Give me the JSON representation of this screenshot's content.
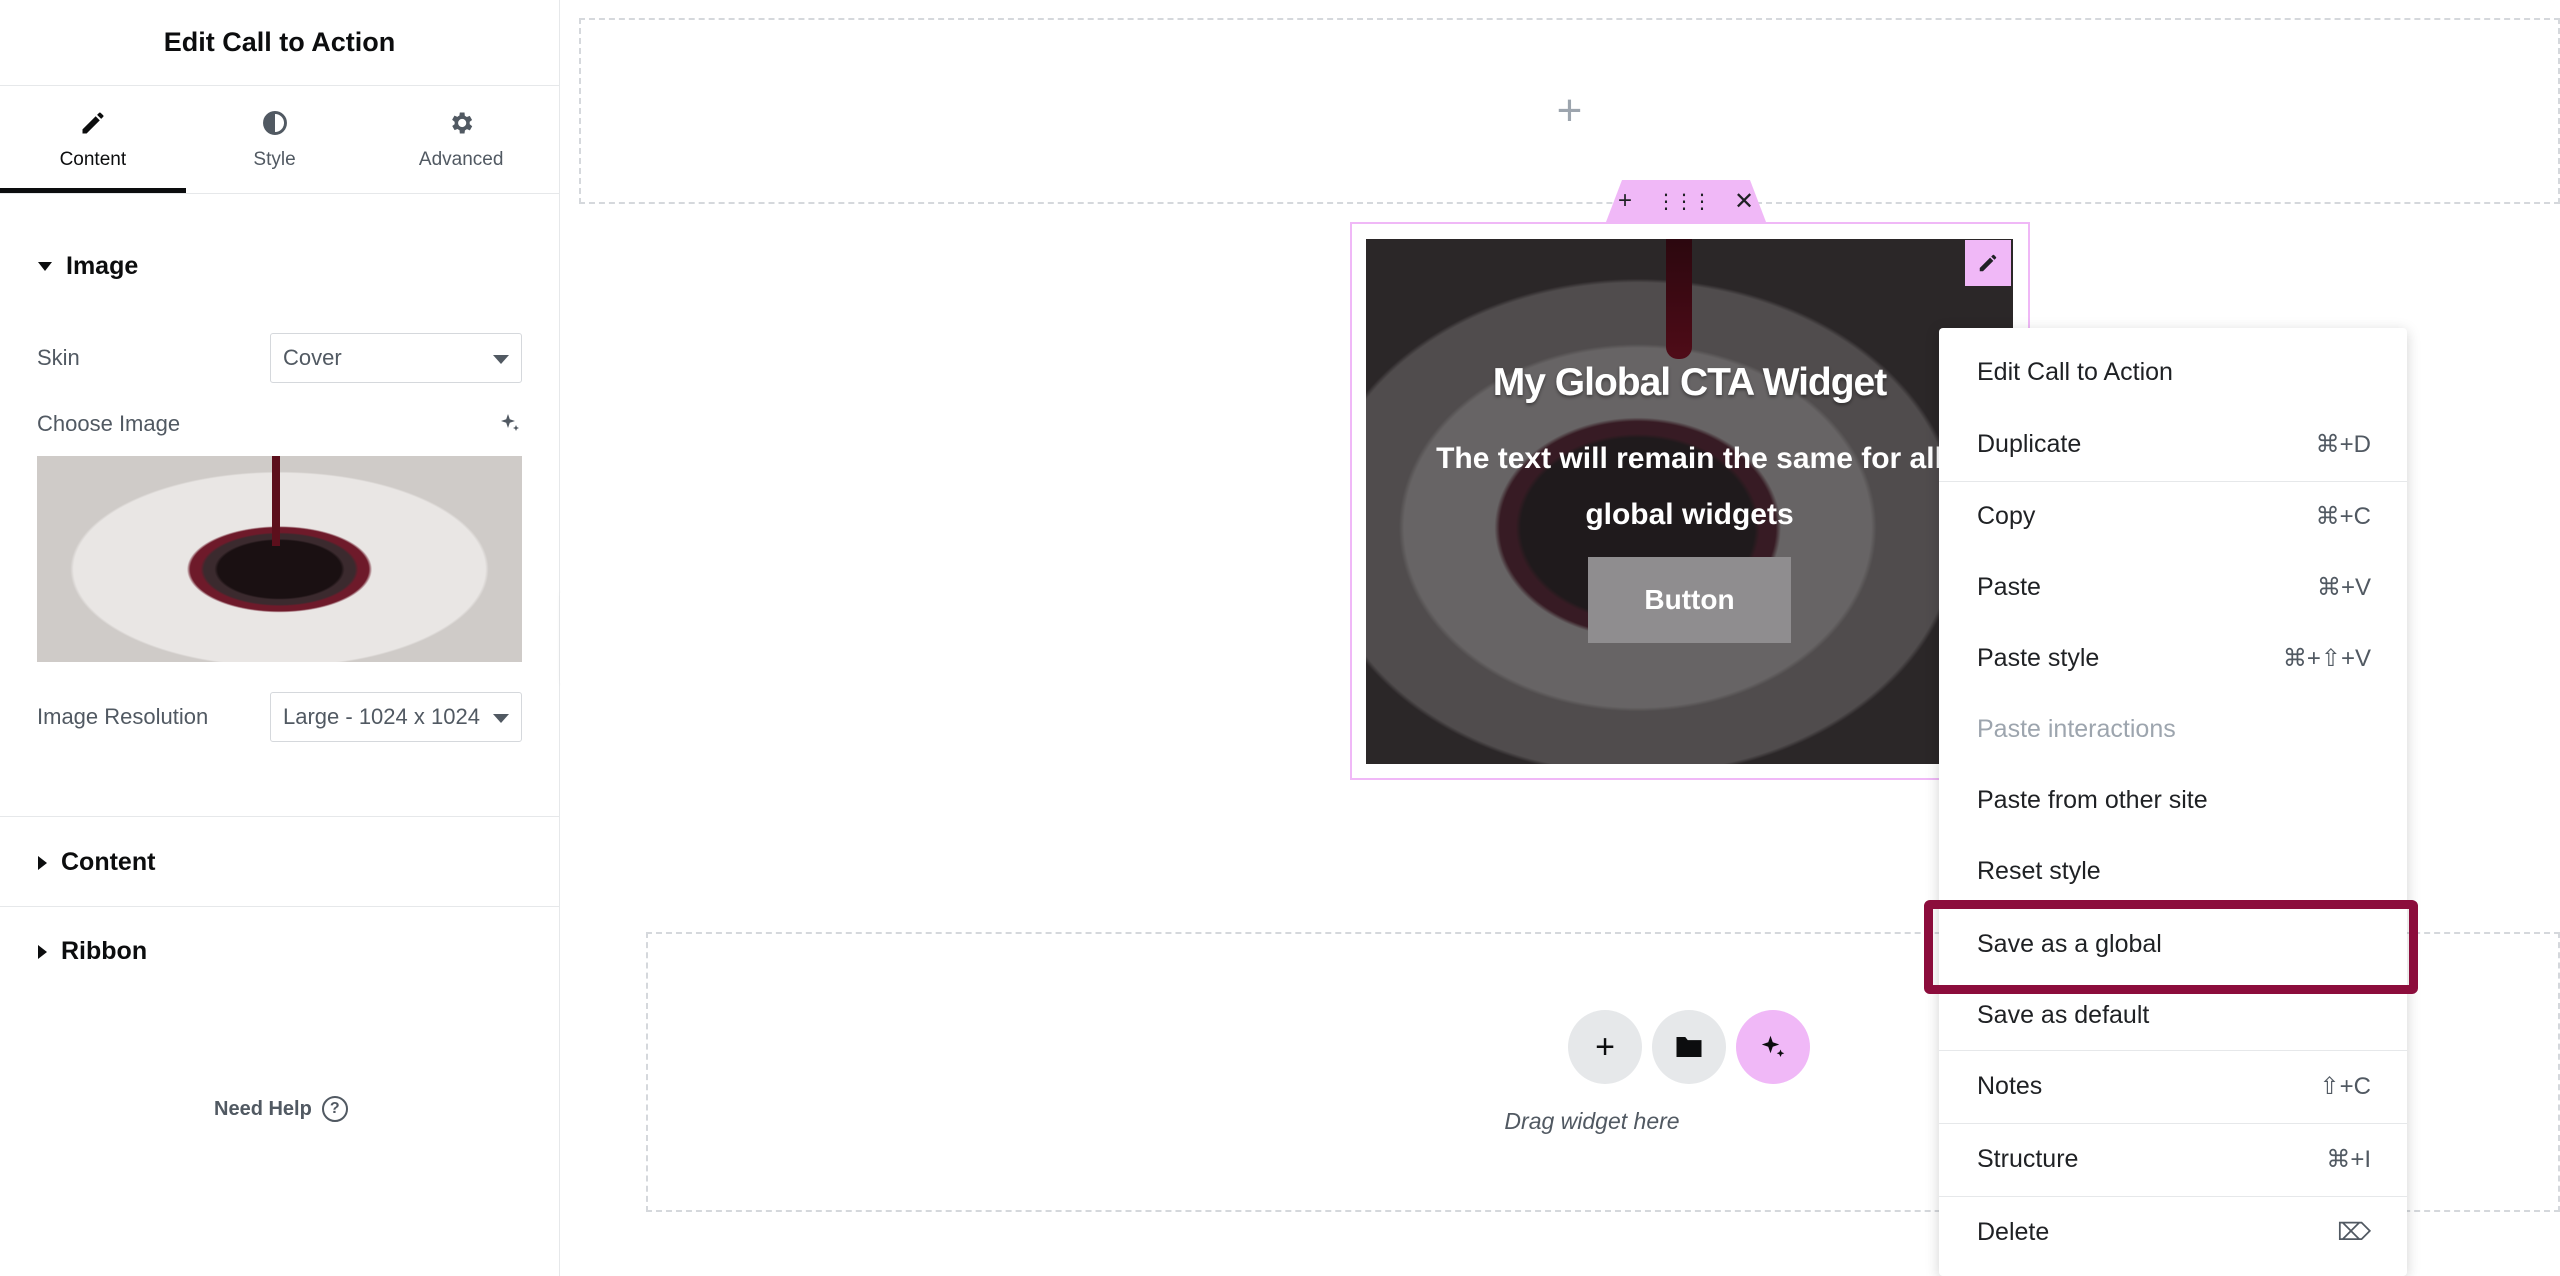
{
  "panel": {
    "title": "Edit Call to Action",
    "tabs": [
      {
        "label": "Content",
        "icon": "pencil-icon"
      },
      {
        "label": "Style",
        "icon": "half-circle-icon"
      },
      {
        "label": "Advanced",
        "icon": "gear-icon"
      }
    ],
    "sections": {
      "image": "Image",
      "content": "Content",
      "ribbon": "Ribbon"
    },
    "skin_label": "Skin",
    "skin_value": "Cover",
    "choose_image_label": "Choose Image",
    "image_resolution_label": "Image Resolution",
    "image_resolution_value": "Large - 1024 x 1024",
    "need_help": "Need Help"
  },
  "canvas": {
    "add_icon": "+",
    "cta_title": "My Global CTA Widget",
    "cta_description": "The text will remain the same for all global widgets",
    "cta_button": "Button",
    "drag_text": "Drag widget here"
  },
  "context_menu": {
    "items": [
      {
        "label": "Edit Call to Action",
        "shortcut": ""
      },
      {
        "label": "Duplicate",
        "shortcut": "⌘+D"
      },
      {
        "label": "Copy",
        "shortcut": "⌘+C"
      },
      {
        "label": "Paste",
        "shortcut": "⌘+V"
      },
      {
        "label": "Paste style",
        "shortcut": "⌘+⇧+V"
      },
      {
        "label": "Paste interactions",
        "shortcut": ""
      },
      {
        "label": "Paste from other site",
        "shortcut": ""
      },
      {
        "label": "Reset style",
        "shortcut": ""
      },
      {
        "label": "Save as a global",
        "shortcut": ""
      },
      {
        "label": "Save as default",
        "shortcut": ""
      },
      {
        "label": "Notes",
        "shortcut": "⇧+C"
      },
      {
        "label": "Structure",
        "shortcut": "⌘+I"
      },
      {
        "label": "Delete",
        "shortcut": "⌦"
      }
    ]
  },
  "colors": {
    "accent_pink": "#f0b8f7",
    "highlight": "#8c0d3c"
  }
}
